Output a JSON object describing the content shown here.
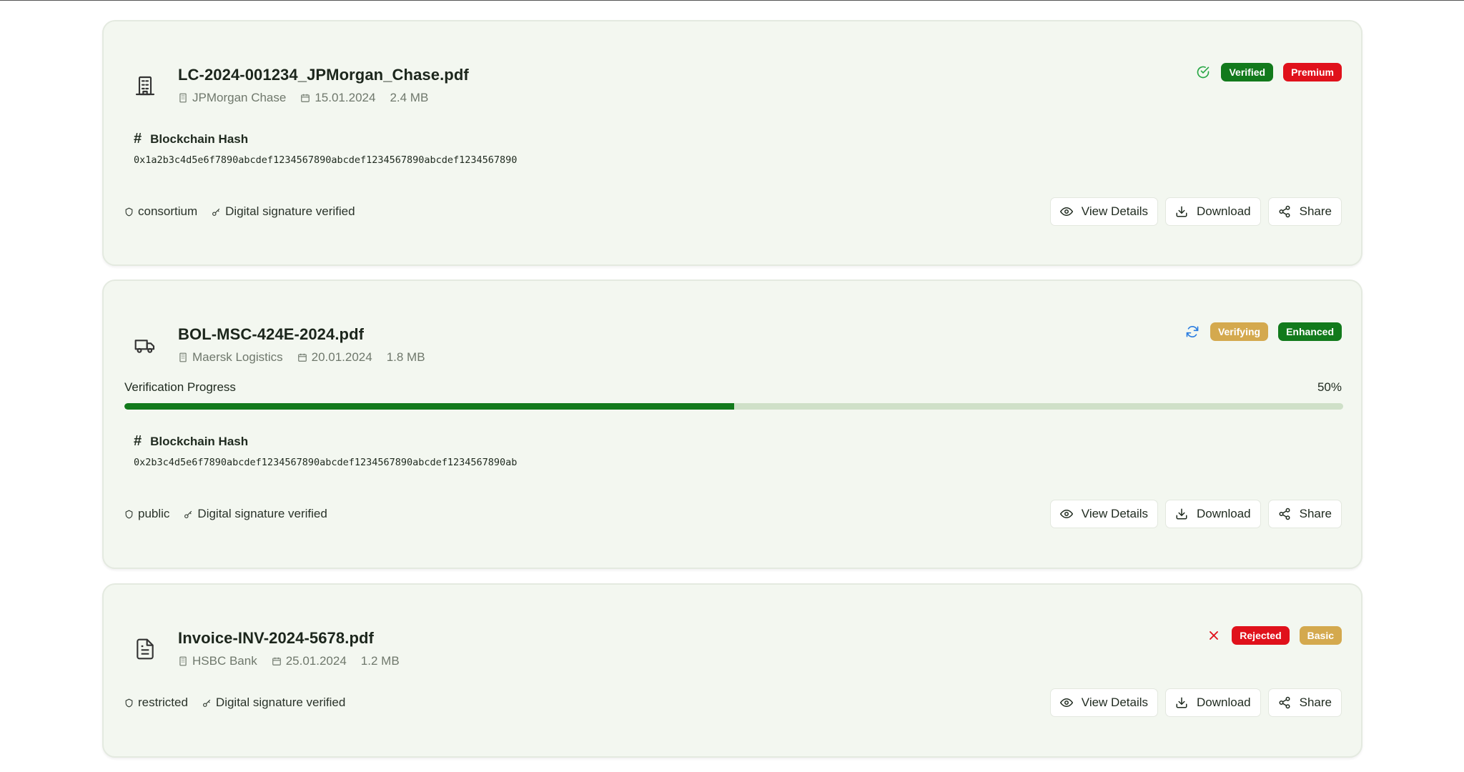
{
  "colors": {
    "verified": "#127a1c",
    "premium": "#e0111b",
    "verifying": "#d4a94e",
    "enhanced": "#127a1c",
    "rejected": "#e0111b",
    "basic": "#d4a94e",
    "progress_fill": "#127a1c",
    "progress_track": "#cfe0c8"
  },
  "actions": {
    "view_details": "View Details",
    "download": "Download",
    "share": "Share"
  },
  "documents": [
    {
      "doc_icon": "building-document-icon",
      "title": "LC-2024-001234_JPMorgan_Chase.pdf",
      "issuer": "JPMorgan Chase",
      "date": "15.01.2024",
      "size": "2.4 MB",
      "status_icon": "check-circle-icon",
      "status": "Verified",
      "tier": "Premium",
      "hash_label": "Blockchain Hash",
      "hash": "0x1a2b3c4d5e6f7890abcdef1234567890abcdef1234567890abcdef1234567890",
      "access": "consortium",
      "signature": "Digital signature verified"
    },
    {
      "doc_icon": "truck-icon",
      "title": "BOL-MSC-424E-2024.pdf",
      "issuer": "Maersk Logistics",
      "date": "20.01.2024",
      "size": "1.8 MB",
      "status_icon": "refresh-icon",
      "status": "Verifying",
      "tier": "Enhanced",
      "progress_label": "Verification Progress",
      "progress_value": 0.5,
      "progress_text": "50%",
      "hash_label": "Blockchain Hash",
      "hash": "0x2b3c4d5e6f7890abcdef1234567890abcdef1234567890abcdef1234567890ab",
      "access": "public",
      "signature": "Digital signature verified"
    },
    {
      "doc_icon": "file-text-icon",
      "title": "Invoice-INV-2024-5678.pdf",
      "issuer": "HSBC Bank",
      "date": "25.01.2024",
      "size": "1.2 MB",
      "status_icon": "x-icon",
      "status": "Rejected",
      "tier": "Basic",
      "access": "restricted",
      "signature": "Digital signature verified"
    }
  ]
}
